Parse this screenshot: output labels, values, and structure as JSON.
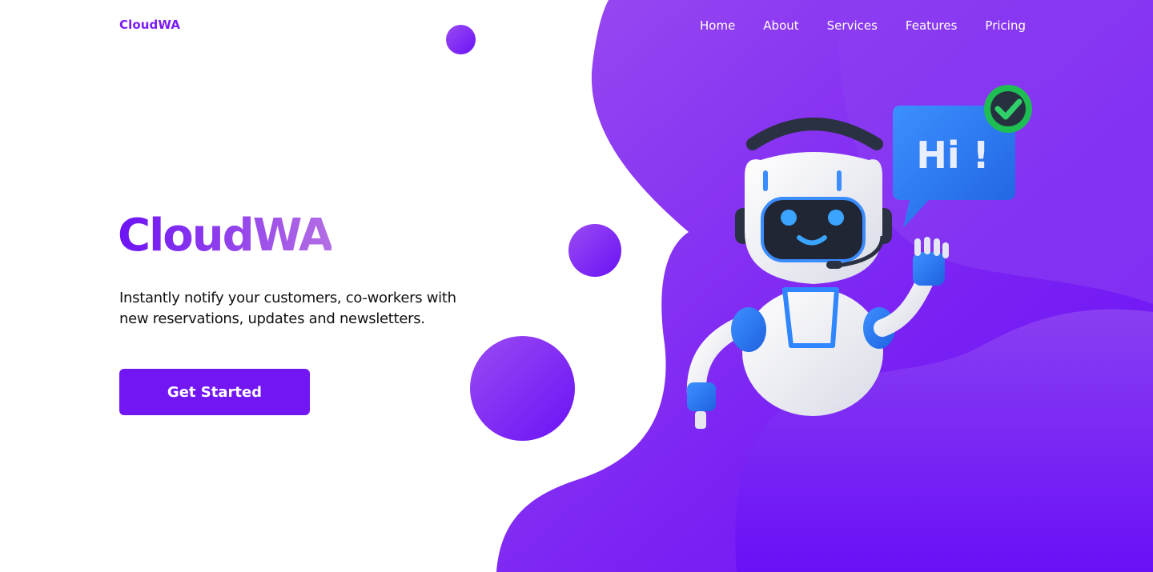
{
  "brand": {
    "logo_text": "CloudWA"
  },
  "nav": {
    "items": [
      {
        "label": "Home"
      },
      {
        "label": "About"
      },
      {
        "label": "Services"
      },
      {
        "label": "Features"
      },
      {
        "label": "Pricing"
      }
    ]
  },
  "hero": {
    "title": "CloudWA",
    "subtitle": "Instantly notify your customers, co-workers with new reservations, updates and newsletters.",
    "cta_label": "Get Started"
  },
  "illustration": {
    "bubble_text": "Hi !"
  },
  "colors": {
    "brand_purple": "#7216f4",
    "blob_light": "#9a4cf0",
    "blob_dark": "#6a10f6",
    "bubble_blue": "#2b7cf0",
    "check_green": "#2fd06a"
  }
}
